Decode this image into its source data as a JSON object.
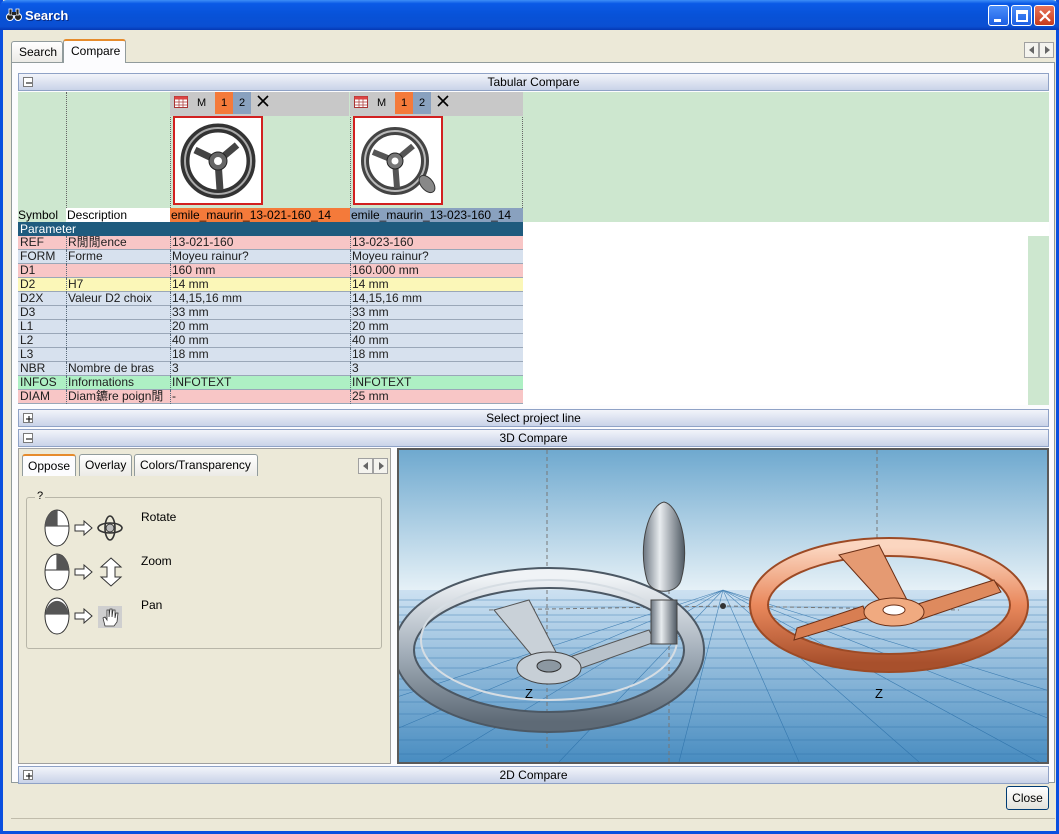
{
  "window": {
    "title": "Search"
  },
  "main_tabs": [
    {
      "label": "Search"
    },
    {
      "label": "Compare"
    }
  ],
  "sections": {
    "tabular": "Tabular Compare",
    "project_line": "Select project line",
    "compare3d": "3D Compare",
    "compare2d": "2D Compare"
  },
  "columns": [
    {
      "m": "M",
      "b1": "1",
      "b2": "2",
      "name": "emile_maurin_13-021-160_14"
    },
    {
      "m": "M",
      "b1": "1",
      "b2": "2",
      "name": "emile_maurin_13-023-160_14"
    }
  ],
  "headers": {
    "symbol": "Symbol",
    "description": "Description",
    "parameter": "Parameter"
  },
  "rows": [
    {
      "symbol": "REF",
      "description": "R閒閒ence",
      "v1": "13-021-160",
      "v2": "13-023-160",
      "color": "#f8c6c6"
    },
    {
      "symbol": "FORM",
      "description": "Forme",
      "v1": "Moyeu rainur?",
      "v2": "Moyeu rainur?",
      "color": "#d7e1ee"
    },
    {
      "symbol": "D1",
      "description": "",
      "v1": "160 mm",
      "v2": "160.000 mm",
      "color": "#f8c6c6"
    },
    {
      "symbol": "D2",
      "description": "H7",
      "v1": "14 mm",
      "v2": "14 mm",
      "color": "#fbf7b8"
    },
    {
      "symbol": "D2X",
      "description": "Valeur D2 choix",
      "v1": "14,15,16 mm",
      "v2": "14,15,16 mm",
      "color": "#d7e1ee"
    },
    {
      "symbol": "D3",
      "description": "",
      "v1": "33 mm",
      "v2": "33 mm",
      "color": "#d7e1ee"
    },
    {
      "symbol": "L1",
      "description": "",
      "v1": "20 mm",
      "v2": "20 mm",
      "color": "#d7e1ee"
    },
    {
      "symbol": "L2",
      "description": "",
      "v1": "40 mm",
      "v2": "40 mm",
      "color": "#d7e1ee"
    },
    {
      "symbol": "L3",
      "description": "",
      "v1": "18 mm",
      "v2": "18 mm",
      "color": "#d7e1ee"
    },
    {
      "symbol": "NBR",
      "description": "Nombre de bras",
      "v1": "3",
      "v2": "3",
      "color": "#d7e1ee"
    },
    {
      "symbol": "INFOS",
      "description": "Informations",
      "v1": "INFOTEXT",
      "v2": "INFOTEXT",
      "color": "#aef0c4"
    },
    {
      "symbol": "DIAM",
      "description": "Diam鑣re poign閒",
      "v1": "-",
      "v2": "25 mm",
      "color": "#f8c6c6"
    }
  ],
  "compare3d": {
    "tabs": [
      {
        "label": "Oppose"
      },
      {
        "label": "Overlay"
      },
      {
        "label": "Colors/Transparency"
      }
    ],
    "help_group": "?",
    "help": [
      {
        "label": "Rotate"
      },
      {
        "label": "Zoom"
      },
      {
        "label": "Pan"
      }
    ],
    "axis_label_1": "Z",
    "axis_label_2": "Z"
  },
  "buttons": {
    "close": "Close"
  }
}
